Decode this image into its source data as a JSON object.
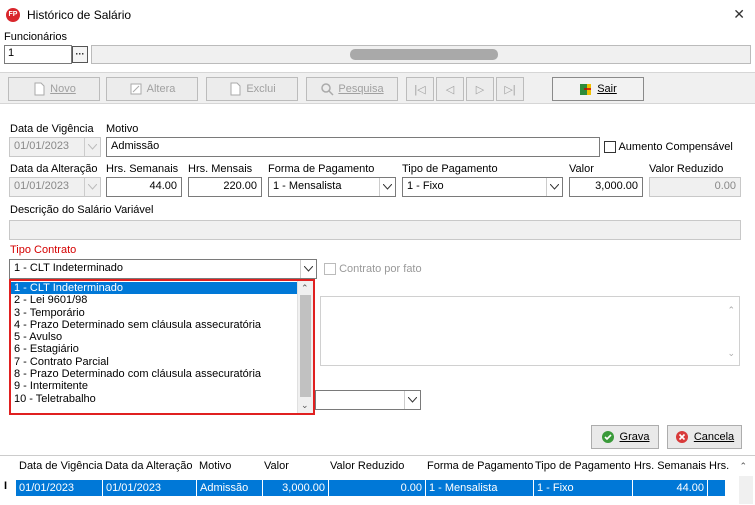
{
  "window": {
    "title": "Histórico de Salário",
    "app_badge": "FP",
    "close": "✕"
  },
  "funcionarios": {
    "label": "Funcionários",
    "value": "1",
    "lookup": "···"
  },
  "toolbar": {
    "novo": "Novo",
    "altera": "Altera",
    "exclui": "Exclui",
    "pesquisa": "Pesquisa",
    "first": "|◁",
    "prev": "◁",
    "next": "▷",
    "last": "▷|",
    "sair": "Sair"
  },
  "form": {
    "data_vigencia_label": "Data de Vigência",
    "data_vigencia": "01/01/2023",
    "motivo_label": "Motivo",
    "motivo": "Admissão",
    "aumento_label": "Aumento Compensável",
    "data_alteracao_label": "Data da Alteração",
    "data_alteracao": "01/01/2023",
    "hrs_semanais_label": "Hrs. Semanais",
    "hrs_semanais": "44.00",
    "hrs_mensais_label": "Hrs. Mensais",
    "hrs_mensais": "220.00",
    "forma_pagamento_label": "Forma de Pagamento",
    "forma_pagamento": "1  -  Mensalista",
    "tipo_pagamento_label": "Tipo de Pagamento",
    "tipo_pagamento": "1  - Fixo",
    "valor_label": "Valor",
    "valor": "3,000.00",
    "valor_reduzido_label": "Valor Reduzido",
    "valor_reduzido": "0.00",
    "descricao_label": "Descrição do Salário Variável",
    "tipo_contrato_label": "Tipo Contrato",
    "tipo_contrato": "1  -  CLT Indeterminado",
    "contrato_fato_label": "Contrato por fato"
  },
  "dropdown": {
    "items": [
      "1  -  CLT Indeterminado",
      "2  -  Lei 9601/98",
      "3  -  Temporário",
      "4  -  Prazo Determinado sem cláusula assecuratória",
      "5  -  Avulso",
      "6  -  Estagiário",
      "7  -  Contrato Parcial",
      "8  -  Prazo Determinado com cláusula assecuratória",
      "9  -  Intermitente",
      "10  -  Teletrabalho"
    ],
    "selected_index": 0
  },
  "actions": {
    "grava": "Grava",
    "cancela": "Cancela"
  },
  "grid": {
    "headers": [
      "Data de Vigência",
      "Data da Alteração",
      "Motivo",
      "Valor",
      "Valor Reduzido",
      "Forma de Pagamento",
      "Tipo de Pagamento",
      "Hrs. Semanais",
      "Hrs."
    ],
    "row_marker": "I",
    "rows": [
      [
        "01/01/2023",
        "01/01/2023",
        "Admissão",
        "3,000.00",
        "0.00",
        "1 - Mensalista",
        "1 - Fixo",
        "44.00",
        ""
      ]
    ]
  },
  "colors": {
    "selection": "#0078d7",
    "dropdown_border": "#e02020",
    "label_red": "#d40000",
    "app_icon": "#d9262c"
  }
}
